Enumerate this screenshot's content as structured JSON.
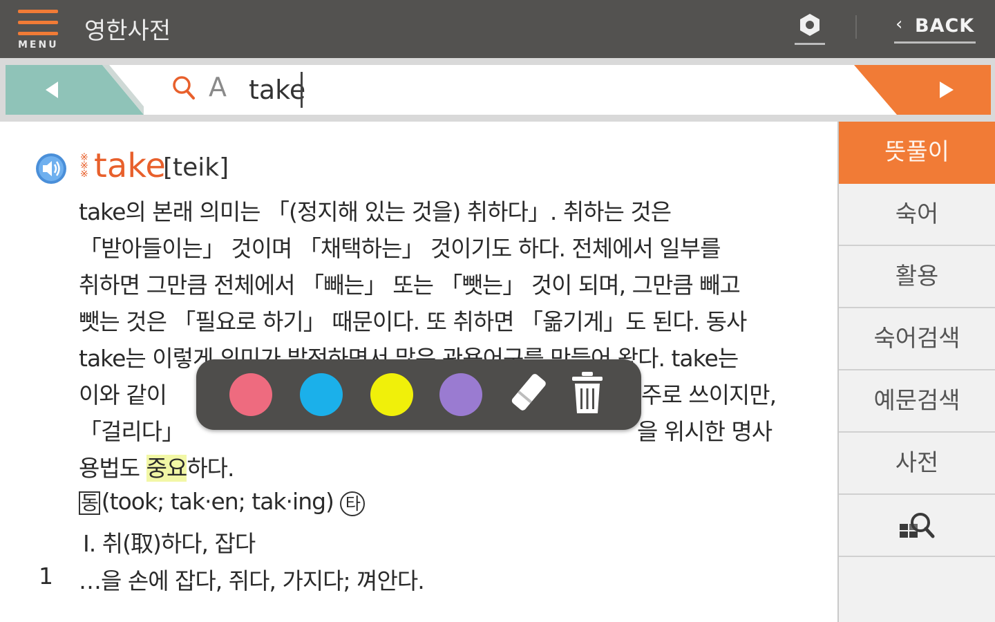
{
  "header": {
    "menu_label": "MENU",
    "title": "영한사전",
    "back_label": "BACK",
    "icons": [
      "menu-icon",
      "settings-icon",
      "chevron-left-icon"
    ],
    "accent_color": "#f17b36",
    "bar_color": "#535250"
  },
  "search": {
    "query": "take",
    "font_toggle_label": "A",
    "prev_color": "#8fc3b8",
    "next_color": "#f17b36"
  },
  "entry": {
    "headword": "take",
    "pronunciation": "[teik]",
    "paragraph_lines": [
      "take의 본래 의미는 「(정지해 있는 것을) 취하다」. 취하는 것은",
      "「받아들이는」 것이며 「채택하는」 것이기도 하다. 전체에서 일부를",
      "취하면 그만큼 전체에서 「빼는」 또는 「뺏는」 것이 되며, 그만큼 빼고",
      "뺏는 것은 「필요로 하기」 때문이다. 또 취하면 「옮기게」도 된다. 동사",
      "take는 이렇게 의미가 발전하면서 많은 관용어구를 만들어 왔다. take는",
      "이와 같이",
      "주로 쓰이지만,",
      "「걸리다」",
      "을 위시한 명사",
      "용법도 ",
      "중요",
      "하다."
    ],
    "pos_mark": "동",
    "forms": "(took; tak·en; tak·ing)",
    "forms_mark": "타",
    "sense_heading": "Ⅰ. 취(取)하다, 잡다",
    "sense_number": "1",
    "sense_text": "…을 손에 잡다, 쥐다, 가지다; 껴안다."
  },
  "side_tabs": {
    "items": [
      {
        "label": "뜻풀이",
        "active": true
      },
      {
        "label": "숙어",
        "active": false
      },
      {
        "label": "활용",
        "active": false
      },
      {
        "label": "숙어검색",
        "active": false
      },
      {
        "label": "예문검색",
        "active": false
      },
      {
        "label": "사전",
        "active": false
      },
      {
        "label": "",
        "icon": "dictionary-search-icon",
        "active": false
      }
    ]
  },
  "highlighter": {
    "colors": [
      "#ee6b7f",
      "#1bb0ea",
      "#f0f00a",
      "#9a7bd1"
    ],
    "color_names": [
      "pink",
      "blue",
      "yellow",
      "purple"
    ],
    "tools": [
      "eraser-icon",
      "trash-icon"
    ]
  }
}
